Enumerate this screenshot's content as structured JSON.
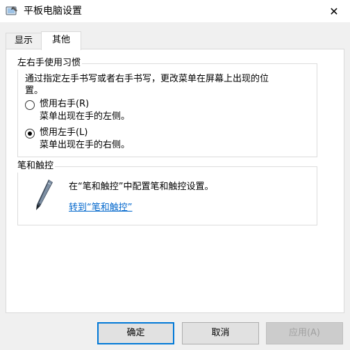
{
  "window": {
    "title": "平板电脑设置",
    "close_symbol": "✕"
  },
  "tabs": [
    {
      "label": "显示",
      "selected": false
    },
    {
      "label": "其他",
      "selected": true
    }
  ],
  "handedness": {
    "title": "左右手使用习惯",
    "description_line1": "通过指定左手书写或者右手书写，更改菜单在屏幕上出现的位",
    "description_line2": "置。",
    "options": [
      {
        "label": "惯用右手(R)",
        "sublabel": "菜单出现在手的左侧。",
        "checked": false
      },
      {
        "label": "惯用左手(L)",
        "sublabel": "菜单出现在手的右侧。",
        "checked": true
      }
    ]
  },
  "pen_touch": {
    "title": "笔和触控",
    "text": "在“笔和触控”中配置笔和触控设置。",
    "link": "转到“笔和触控”",
    "icon": "pen-icon"
  },
  "buttons": {
    "ok": "确定",
    "cancel": "取消",
    "apply": "应用(A)"
  },
  "colors": {
    "accent": "#0078d7",
    "link": "#0066cc"
  }
}
